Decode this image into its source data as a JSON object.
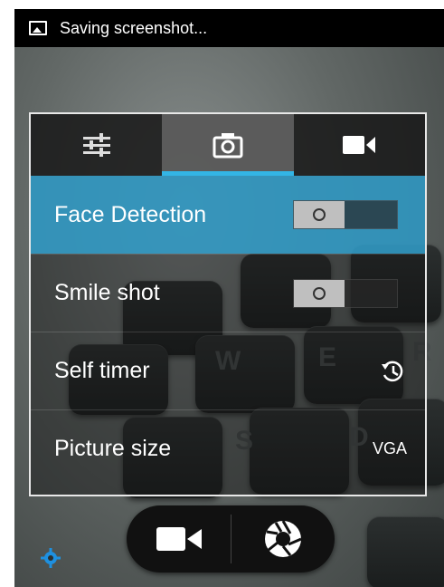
{
  "status_bar": {
    "text": "Saving screenshot..."
  },
  "tabs": [
    {
      "icon": "sliders-icon"
    },
    {
      "icon": "camera-icon",
      "active": true
    },
    {
      "icon": "video-camera-icon"
    }
  ],
  "settings": [
    {
      "label": "Face Detection",
      "control": "toggle",
      "highlighted": true
    },
    {
      "label": "Smile shot",
      "control": "toggle"
    },
    {
      "label": "Self timer",
      "control": "icon",
      "icon": "timer-icon"
    },
    {
      "label": "Picture size",
      "control": "value",
      "value": "VGA"
    }
  ],
  "bottom_controls": {
    "video_icon": "video-camera-icon",
    "shutter_icon": "shutter-icon",
    "settings_icon": "gear-icon"
  },
  "colors": {
    "accent": "#33b5e5",
    "status_bar": "#000000"
  }
}
